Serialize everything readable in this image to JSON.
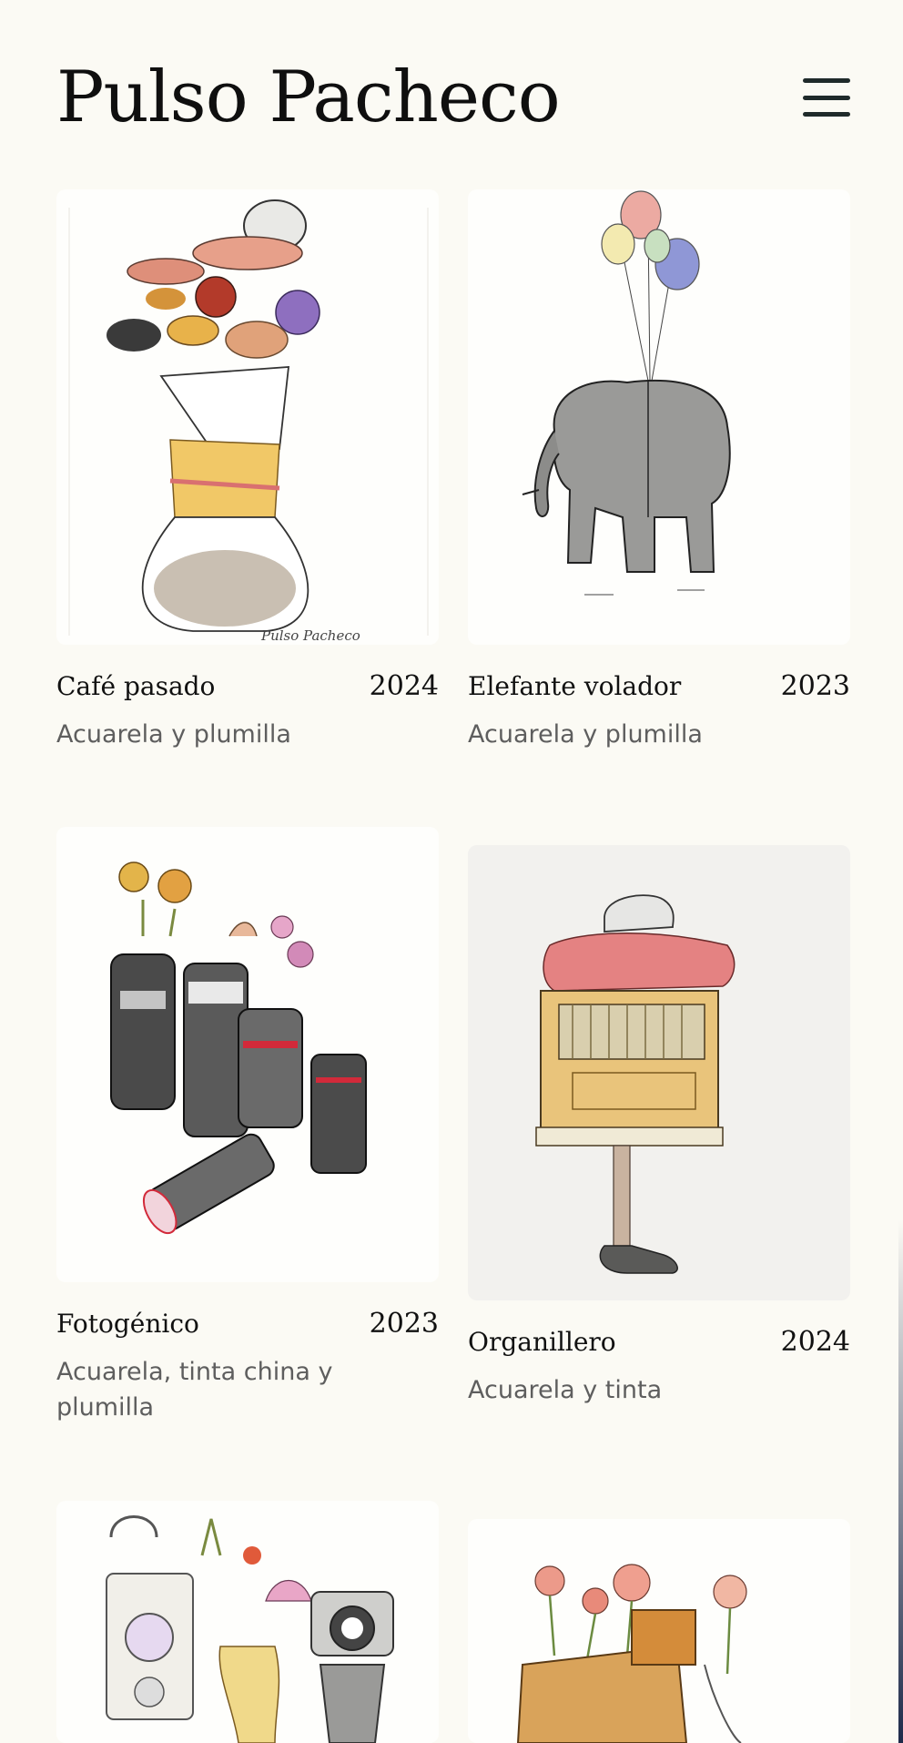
{
  "site": {
    "title": "Pulso Pacheco",
    "menu_icon": "hamburger-menu-icon"
  },
  "artworks": [
    {
      "title": "Café pasado",
      "year": "2024",
      "medium": "Acuarela y plumilla",
      "signature": "Pulso Pacheco"
    },
    {
      "title": "Elefante volador",
      "year": "2023",
      "medium": "Acuarela y plumilla"
    },
    {
      "title": "Fotogénico",
      "year": "2023",
      "medium": "Acuarela, tinta china y plumilla"
    },
    {
      "title": "Organillero",
      "year": "2024",
      "medium": "Acuarela y tinta"
    },
    {
      "title": "",
      "year": "",
      "medium": ""
    },
    {
      "title": "",
      "year": "",
      "medium": ""
    }
  ],
  "colors": {
    "background": "#fbfaf4",
    "text": "#111111",
    "muted": "#5e5e5e"
  }
}
